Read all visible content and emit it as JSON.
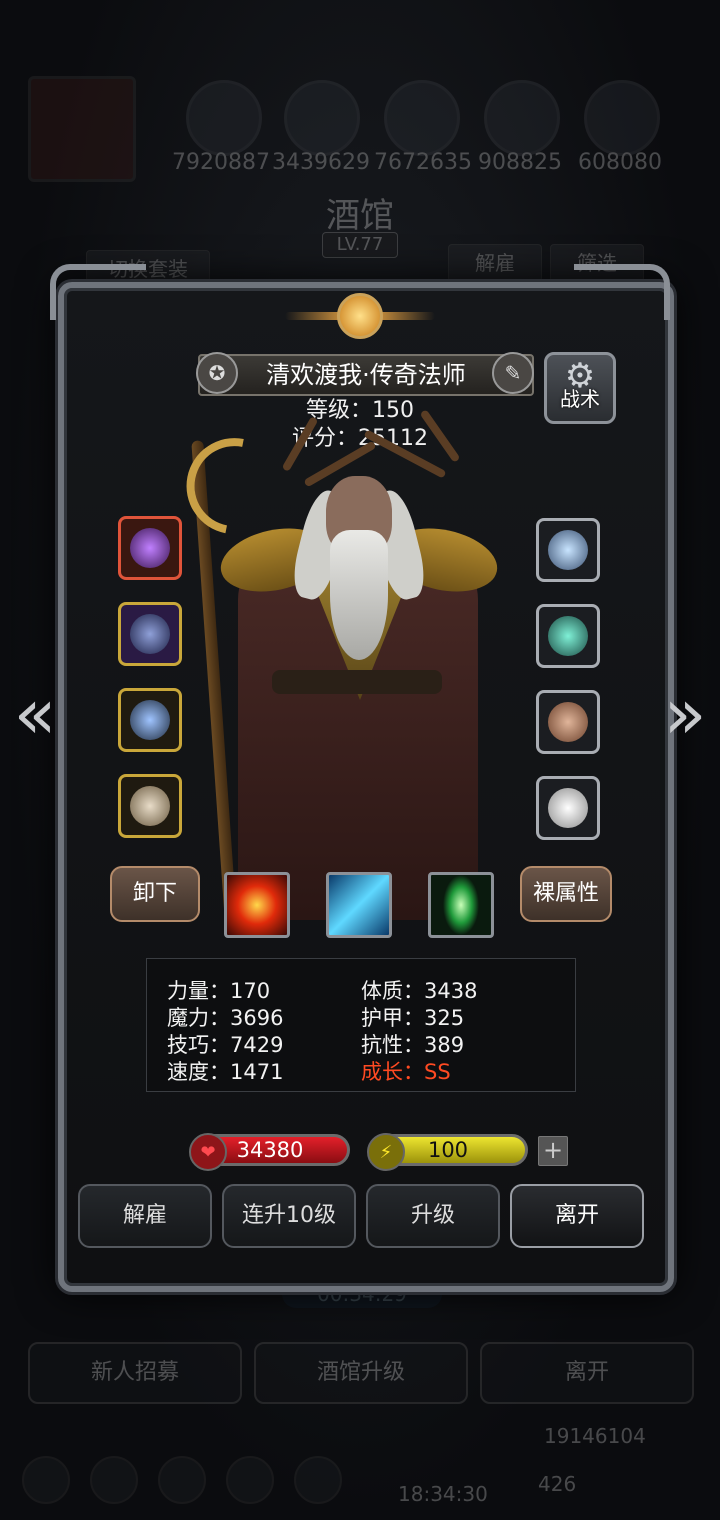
{
  "background": {
    "resources": [
      "7920887",
      "3439629",
      "7672635",
      "908825",
      "608080"
    ],
    "title": "酒馆",
    "level": "LV.77",
    "switch_outfit": "切换套装",
    "dismiss": "解雇",
    "filter": "筛选",
    "timer": "00:34:29",
    "bottom_buttons": [
      "新人招募",
      "酒馆升级",
      "离开"
    ],
    "gold": "19146104",
    "gems": "426",
    "clock": "18:34:30"
  },
  "hero": {
    "name": "清欢渡我·传奇法师",
    "level_text": "等级：150",
    "score_text": "评分：25112",
    "tactics_label": "战术"
  },
  "buttons": {
    "unequip": "卸下",
    "naked_stats": "裸属性"
  },
  "stats": {
    "strength": "力量：170",
    "magic": "魔力：3696",
    "skill": "技巧：7429",
    "speed": "速度：1471",
    "constitution": "体质：3438",
    "armor": "护甲：325",
    "resistance": "抗性：389",
    "growth": "成长：SS"
  },
  "bars": {
    "hp": "34380",
    "energy": "100"
  },
  "actions": [
    "解雇",
    "连升10级",
    "升级",
    "离开"
  ],
  "colors": {
    "growth_text": "#ff4a22",
    "hp": "#e4202a",
    "energy": "#ede530"
  }
}
